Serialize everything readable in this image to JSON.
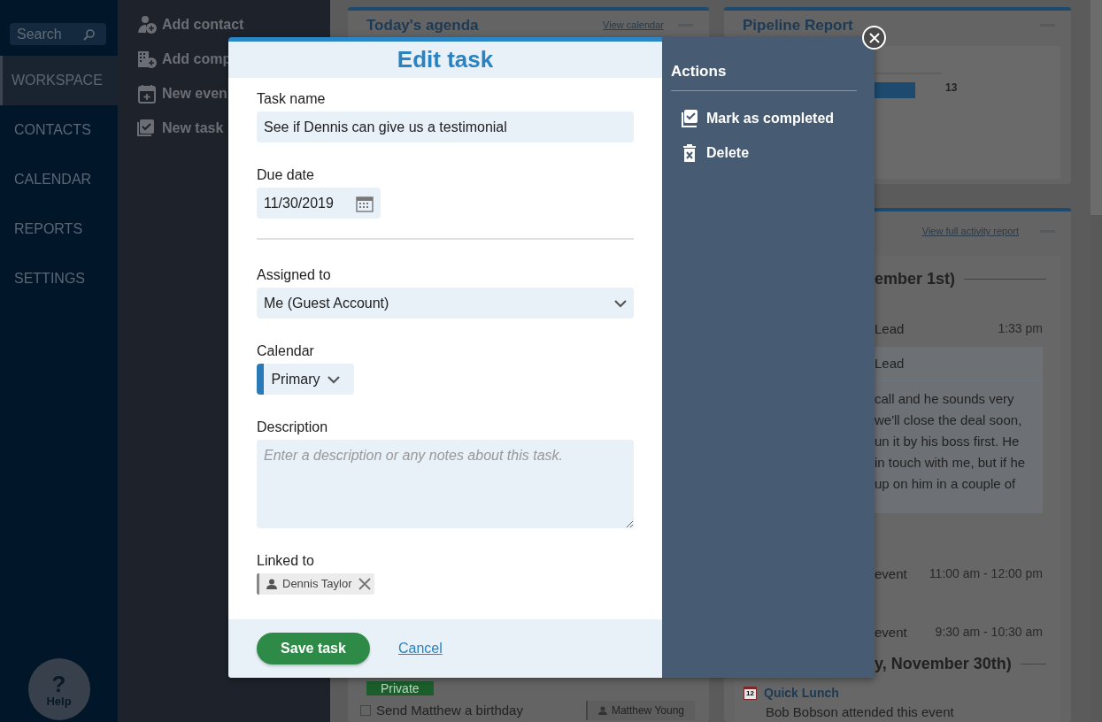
{
  "sidebar": {
    "search": {
      "placeholder": "Search"
    },
    "items": [
      {
        "label": "WORKSPACE",
        "selected": true
      },
      {
        "label": "CONTACTS",
        "selected": false
      },
      {
        "label": "CALENDAR",
        "selected": false
      },
      {
        "label": "REPORTS",
        "selected": false
      },
      {
        "label": "SETTINGS",
        "selected": false
      }
    ],
    "help": {
      "icon": "?",
      "label": "Help"
    }
  },
  "quick_actions": [
    {
      "kind": "contact",
      "label": "Add contact"
    },
    {
      "kind": "company",
      "label": "Add comp"
    },
    {
      "kind": "event",
      "label": "New even"
    },
    {
      "kind": "task",
      "label": "New task"
    }
  ],
  "agenda_card": {
    "title": "Today's agenda",
    "link": "View calendar",
    "badge": "Private",
    "task": {
      "label": "Send Matthew a birthday",
      "checked": false,
      "contact": "Matthew Young"
    }
  },
  "pipeline_card": {
    "title": "Pipeline Report",
    "bar_label": "13"
  },
  "activity_card": {
    "link": "View full activity report",
    "groups": [
      {
        "heading": "ember 1st)",
        "entries": [
          {
            "kind": "note",
            "title": "Lead",
            "time": "1:33 pm",
            "subtitle": "Lead",
            "lines": [
              "call and he sounds very",
              "we'll close the deal soon,",
              "un it by his boss first. He",
              "in touch with me, but if he",
              "up on him in a couple of"
            ]
          },
          {
            "kind": "event",
            "title": "event",
            "time": "11:00 am - 12:00 pm"
          },
          {
            "kind": "event",
            "title": "event",
            "time": "9:30 am - 10:30 am"
          }
        ]
      },
      {
        "heading": "y, November 30th)",
        "entries": [
          {
            "kind": "lunch",
            "icon_label": "12",
            "title": "Quick Lunch",
            "text": "Bob Bobson attended this event"
          }
        ]
      }
    ]
  },
  "modal": {
    "title": "Edit task",
    "fields": [
      {
        "kind": "text",
        "label": "Task name",
        "value": "See if Dennis can give us a testimonial"
      },
      {
        "kind": "date",
        "label": "Due date",
        "value": "11/30/2019"
      },
      {
        "kind": "select",
        "label": "Assigned to",
        "value": "Me (Guest Account)"
      },
      {
        "kind": "calendar",
        "label": "Calendar",
        "value": "Primary",
        "color": "#2a7ab8"
      },
      {
        "kind": "textarea",
        "label": "Description",
        "placeholder": "Enter a description or any notes about this task."
      },
      {
        "kind": "links",
        "label": "Linked to",
        "chips": [
          {
            "label": "Dennis Taylor"
          }
        ]
      }
    ],
    "save": "Save task",
    "cancel": "Cancel",
    "actions": {
      "title": "Actions",
      "items": [
        {
          "kind": "complete",
          "label": "Mark as completed"
        },
        {
          "kind": "delete",
          "label": "Delete"
        }
      ]
    }
  }
}
